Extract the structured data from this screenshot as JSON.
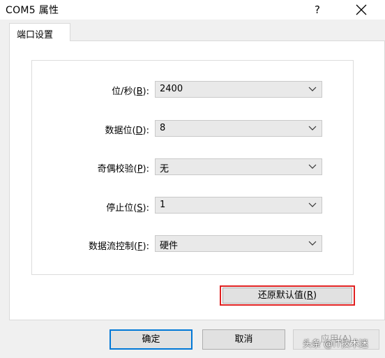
{
  "window": {
    "title": "COM5 属性",
    "help_label": "?"
  },
  "tabs": [
    {
      "label": "端口设置",
      "active": true
    }
  ],
  "settings": [
    {
      "label": "位/秒(",
      "mnemonic": "B",
      "suffix": "):",
      "value": "2400"
    },
    {
      "label": "数据位(",
      "mnemonic": "D",
      "suffix": "):",
      "value": "8"
    },
    {
      "label": "奇偶校验(",
      "mnemonic": "P",
      "suffix": "):",
      "value": "无"
    },
    {
      "label": "停止位(",
      "mnemonic": "S",
      "suffix": "):",
      "value": "1"
    },
    {
      "label": "数据流控制(",
      "mnemonic": "F",
      "suffix": "):",
      "value": "硬件"
    }
  ],
  "restore_button": {
    "label": "还原默认值(",
    "mnemonic": "R",
    "suffix": ")"
  },
  "footer": {
    "ok_label": "确定",
    "cancel_label": "取消",
    "apply_label": "应用(A)"
  },
  "watermark": "头条 @IT技术迷",
  "colors": {
    "highlight_frame": "#e02020",
    "default_button_border": "#0078d7"
  }
}
